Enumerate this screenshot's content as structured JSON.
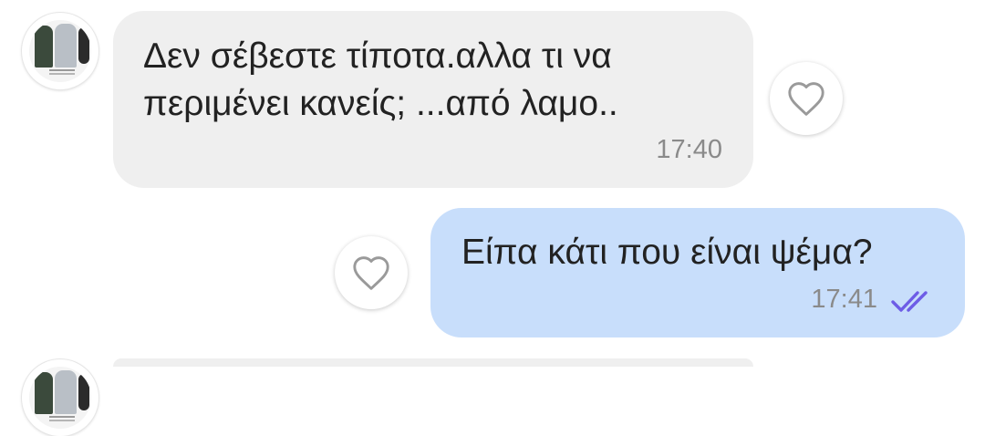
{
  "messages": [
    {
      "direction": "incoming",
      "text_lines": [
        "Δεν σέβεστε τίποτα.αλλα τι να",
        "περιμένει κανείς; ...από λαμο.."
      ],
      "time": "17:40",
      "like_icon": "heart-outline-icon"
    },
    {
      "direction": "outgoing",
      "text_lines": [
        "Είπα κάτι που είναι ψέμα?"
      ],
      "time": "17:41",
      "status_icon": "double-check-icon",
      "status_color": "#6d5ce6",
      "like_icon": "heart-outline-icon"
    }
  ],
  "colors": {
    "incoming_bubble": "#efefef",
    "outgoing_bubble": "#c8defb",
    "text": "#222222",
    "time": "#8a8a8a"
  }
}
